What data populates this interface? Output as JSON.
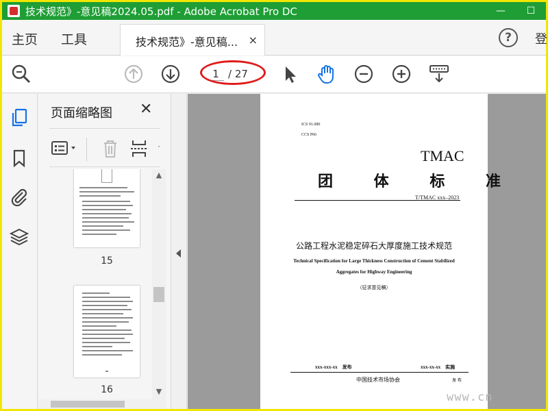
{
  "window": {
    "title": "技术规范》-意见稿2024.05.pdf - Adobe Acrobat Pro DC",
    "minimize": "—",
    "maximize": "☐"
  },
  "menu": {
    "home": "主页",
    "tools": "工具",
    "doc_tab": "技术规范》-意见稿...",
    "doc_tab_close": "×",
    "help": "?",
    "signin": "登"
  },
  "toolbar": {
    "current_page": "1",
    "total_pages": "/ 27"
  },
  "thumbnails_panel": {
    "title": "页面缩略图",
    "close": "✕",
    "pages": [
      {
        "number": "15"
      },
      {
        "number": "16"
      }
    ]
  },
  "document_page": {
    "ics": "ICS 91.080",
    "ccs": "CCS P66",
    "tmac": "TMAC",
    "std_type": "团 体 标 准",
    "std_no": "T/TMAC xxx–2023",
    "title_cn": "公路工程水泥稳定碎石大厚度施工技术规范",
    "title_en_1": "Technical Specification for Large Thickness Construction of Cement Stabilized",
    "title_en_2": "Aggregates for Highway Engineering",
    "draft": "（征求意见稿）",
    "publish_date": "xxx-xxx-xx　发布",
    "implement_date": "xxx-xx-xx　实施",
    "issuer": "中国技术市场协会",
    "issue_word": "发 布"
  },
  "watermark": "www.cn",
  "colors": {
    "titlebar": "#1e9e35",
    "frame": "#f2e600",
    "annotation": "#e01b1b",
    "accent_icon": "#1473e6"
  }
}
